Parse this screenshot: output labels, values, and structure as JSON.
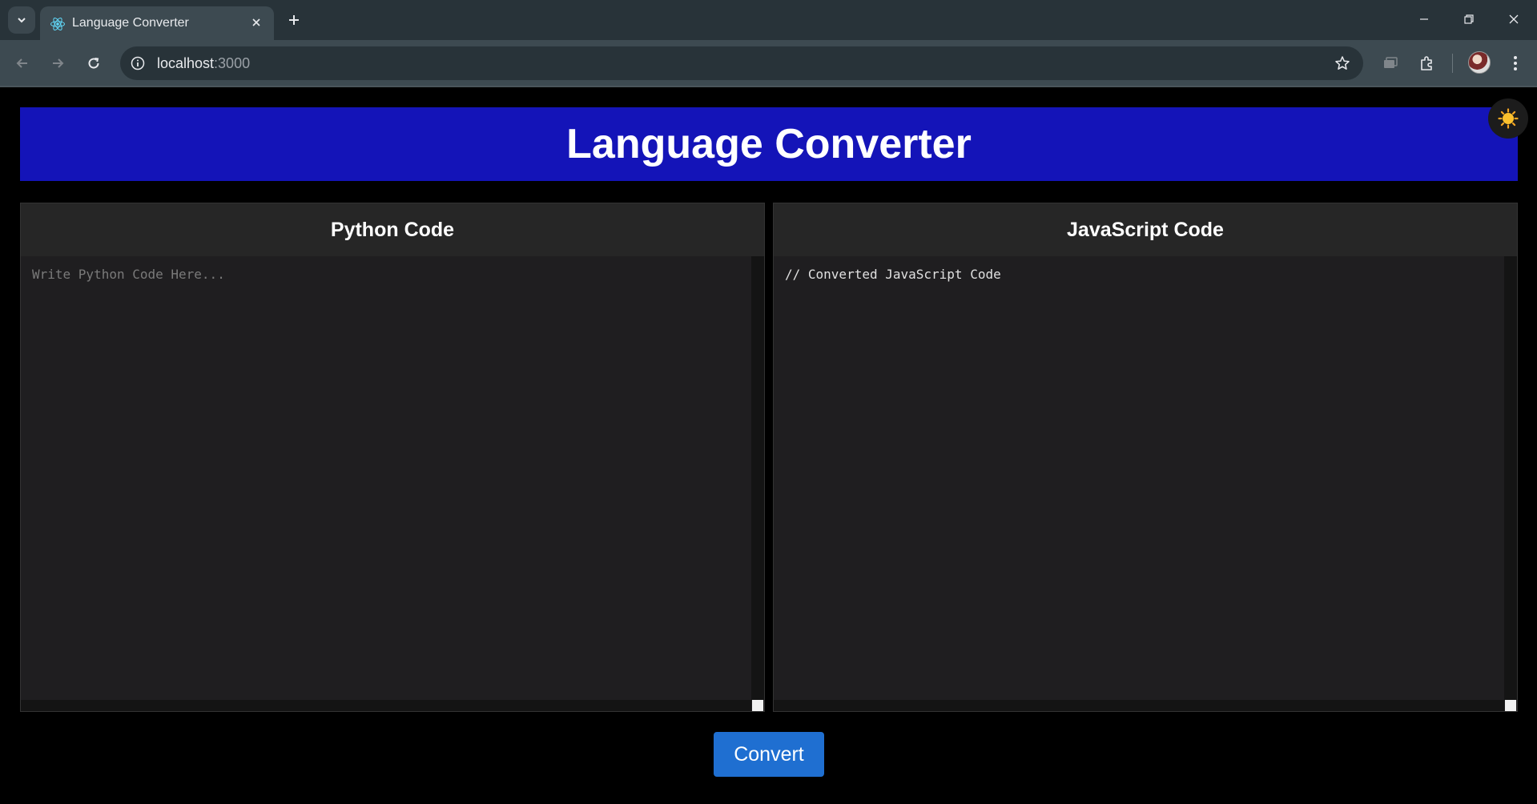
{
  "browser": {
    "tab_title": "Language Converter",
    "url_host": "localhost",
    "url_port": ":3000"
  },
  "page": {
    "title": "Language Converter",
    "theme_icon": "sun-icon",
    "python_panel": {
      "title": "Python Code",
      "placeholder": "Write Python Code Here...",
      "value": ""
    },
    "js_panel": {
      "title": "JavaScript Code",
      "value": "// Converted JavaScript Code"
    },
    "convert_label": "Convert"
  },
  "colors": {
    "header_bg": "#1414b8",
    "button_bg": "#1f6fd1",
    "panel_bg": "#1f1e20",
    "page_bg": "#000000"
  }
}
